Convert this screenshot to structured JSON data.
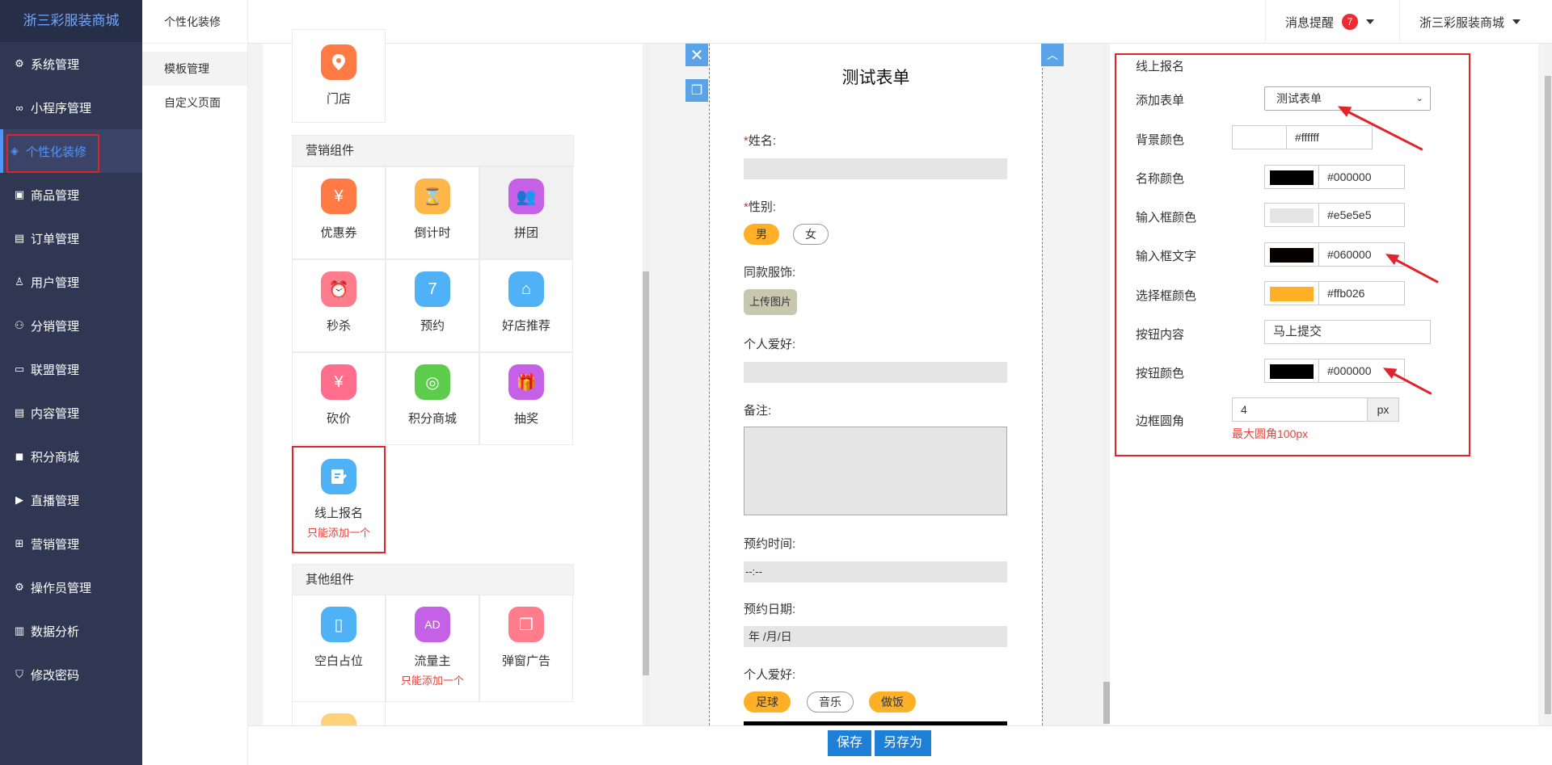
{
  "brand": "浙三彩服装商城",
  "nav": [
    {
      "label": "系统管理",
      "icon": "gear-icon"
    },
    {
      "label": "小程序管理",
      "icon": "link-icon"
    },
    {
      "label": "个性化装修",
      "icon": "diamond-icon"
    },
    {
      "label": "商品管理",
      "icon": "bag-icon"
    },
    {
      "label": "订单管理",
      "icon": "clipboard-icon"
    },
    {
      "label": "用户管理",
      "icon": "user-icon"
    },
    {
      "label": "分销管理",
      "icon": "network-icon"
    },
    {
      "label": "联盟管理",
      "icon": "store-icon"
    },
    {
      "label": "内容管理",
      "icon": "content-icon"
    },
    {
      "label": "积分商城",
      "icon": "cube-icon"
    },
    {
      "label": "直播管理",
      "icon": "play-icon"
    },
    {
      "label": "营销管理",
      "icon": "marketing-icon"
    },
    {
      "label": "操作员管理",
      "icon": "gear-icon"
    },
    {
      "label": "数据分析",
      "icon": "chart-icon"
    },
    {
      "label": "修改密码",
      "icon": "shield-icon"
    }
  ],
  "subnav": {
    "title": "个性化装修",
    "items": [
      "模板管理",
      "自定义页面"
    ]
  },
  "topbar": {
    "messages_label": "消息提醒",
    "messages_count": "7",
    "shop_label": "浙三彩服装商城"
  },
  "palette": {
    "store_label": "门店",
    "marketing_title": "营销组件",
    "marketing": [
      {
        "label": "优惠券",
        "icon": "coupon-icon",
        "color": "#ff7a45"
      },
      {
        "label": "倒计时",
        "icon": "hourglass-icon",
        "color": "#ffb74a"
      },
      {
        "label": "拼团",
        "icon": "group-icon",
        "color": "#c561e6"
      },
      {
        "label": "秒杀",
        "icon": "alarm-icon",
        "color": "#ff7c8c"
      },
      {
        "label": "预约",
        "icon": "calendar-icon",
        "color": "#4fb2f6"
      },
      {
        "label": "好店推荐",
        "icon": "shop-icon",
        "color": "#4fb2f6"
      },
      {
        "label": "砍价",
        "icon": "yen-icon",
        "color": "#ff6f8d"
      },
      {
        "label": "积分商城",
        "icon": "coins-icon",
        "color": "#5dcc4d"
      },
      {
        "label": "抽奖",
        "icon": "gift-icon",
        "color": "#c561e6"
      }
    ],
    "signup_label": "线上报名",
    "signup_note": "只能添加一个",
    "other_title": "其他组件",
    "other": [
      {
        "label": "空白占位",
        "icon": "blank-icon",
        "color": "#4fb2f6",
        "note": ""
      },
      {
        "label": "流量主",
        "icon": "ad-icon",
        "color": "#c561e6",
        "note": "只能添加一个"
      },
      {
        "label": "弹窗广告",
        "icon": "popup-icon",
        "color": "#ff7c8c",
        "note": ""
      }
    ]
  },
  "form": {
    "title": "测试表单",
    "name_label": "姓名:",
    "gender_label": "性别:",
    "gender_options": [
      "男",
      "女"
    ],
    "outfit_label": "同款服饰:",
    "upload_label": "上传图片",
    "hobby_label": "个人爱好:",
    "remark_label": "备注:",
    "time_label": "预约时间:",
    "time_value": "--:--",
    "date_label": "预约日期:",
    "date_value": "年 /月/日",
    "hobby2_label": "个人爱好:",
    "hobby_options": [
      "足球",
      "音乐",
      "做饭"
    ]
  },
  "props": {
    "section_title": "线上报名",
    "add_form_label": "添加表单",
    "add_form_value": "测试表单",
    "bg_label": "背景颜色",
    "bg_value": "#ffffff",
    "name_color_label": "名称颜色",
    "name_color_value": "#000000",
    "input_bg_label": "输入框颜色",
    "input_bg_value": "#e5e5e5",
    "input_text_label": "输入框文字",
    "input_text_value": "#060000",
    "select_color_label": "选择框颜色",
    "select_color_value": "#ffb026",
    "button_text_label": "按钮内容",
    "button_text_value": "马上提交",
    "button_color_label": "按钮颜色",
    "button_color_value": "#000000",
    "radius_label": "边框圆角",
    "radius_value": "4",
    "radius_unit": "px",
    "radius_hint": "最大圆角100px"
  },
  "bottom": {
    "save_label": "保存",
    "save_as_label": "另存为"
  }
}
